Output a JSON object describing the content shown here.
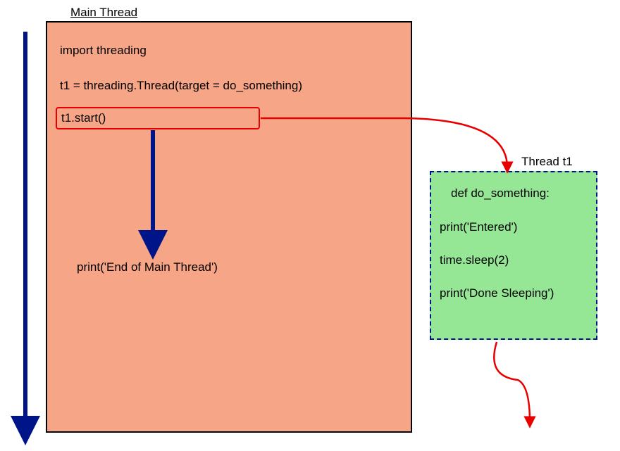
{
  "main_thread": {
    "label": "Main Thread",
    "code": {
      "line1": "import threading",
      "line2": "t1 = threading.Thread(target = do_something)",
      "start_call": "t1.start()",
      "end": "print('End of Main Thread')"
    }
  },
  "thread_t1": {
    "label": "Thread t1",
    "code": {
      "line1": "def do_something:",
      "line2": "print('Entered')",
      "line3": "time.sleep(2)",
      "line4": "print('Done Sleeping')"
    }
  },
  "colors": {
    "main_box_fill": "#f6a586",
    "t1_box_fill": "#95e795",
    "red_stroke": "#e80000",
    "blue_stroke": "#001489"
  }
}
